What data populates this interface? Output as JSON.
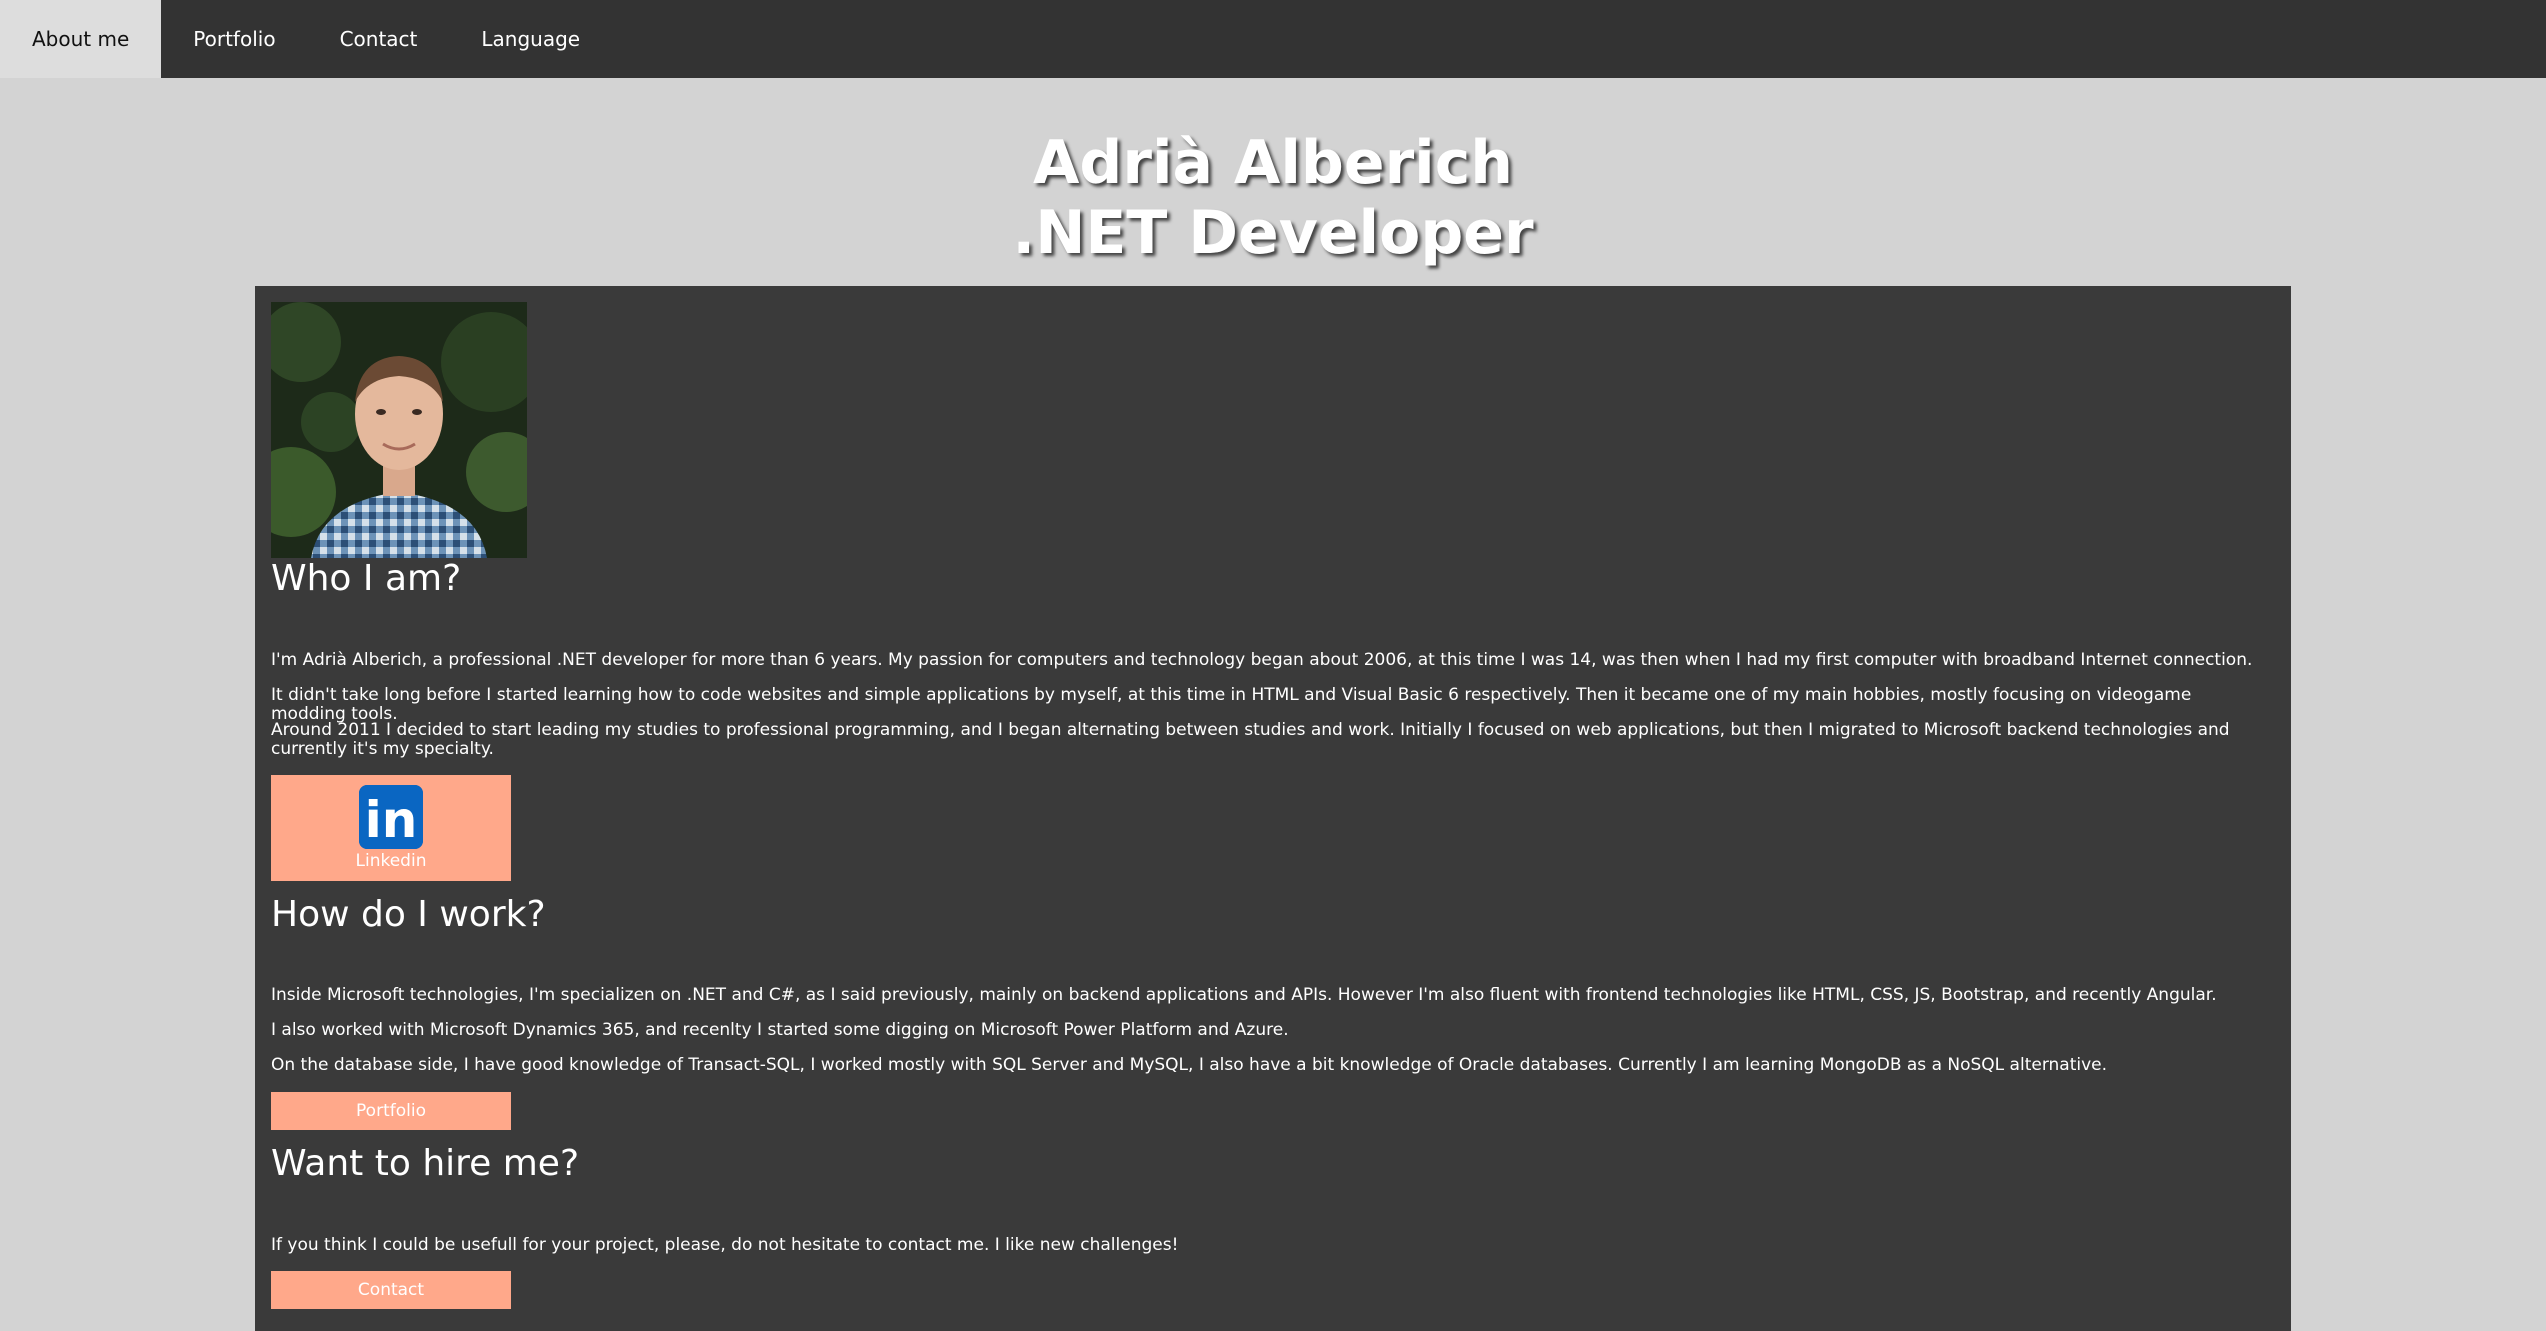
{
  "nav": {
    "items": [
      {
        "label": "About me",
        "active": true
      },
      {
        "label": "Portfolio",
        "active": false
      },
      {
        "label": "Contact",
        "active": false
      },
      {
        "label": "Language",
        "active": false
      }
    ]
  },
  "header": {
    "name": "Adrià Alberich",
    "role": ".NET Developer"
  },
  "about": {
    "title": "Who I am?",
    "paragraphs": [
      "I'm Adrià Alberich, a professional .NET developer for more than 6 years. My passion for computers and technology began about 2006, at this time I was 14, was then when I had my first computer with broadband Internet connection.",
      "It didn't take long before I started learning how to code websites and simple applications by myself, at this time in HTML and Visual Basic 6 respectively. Then it became one of my main hobbies, mostly focusing on videogame modding tools.",
      "Around 2011 I decided to start leading my studies to professional programming, and I began alternating between studies and work. Initially I focused on web applications, but then I migrated to Microsoft backend technologies and currently it's my specialty."
    ],
    "linkedin_label": "Linkedin",
    "linkedin_logo_text": "in"
  },
  "work": {
    "title": "How do I work?",
    "paragraphs": [
      "Inside Microsoft technologies, I'm specializen on .NET and C#, as I said previously, mainly on backend applications and APIs. However I'm also fluent with frontend technologies like HTML, CSS, JS, Bootstrap, and recently Angular.",
      "I also worked with Microsoft Dynamics 365, and recenlty I started some digging on Microsoft Power Platform and Azure.",
      "On the database side, I have good knowledge of Transact-SQL, I worked mostly with SQL Server and MySQL, I also have a bit knowledge of Oracle databases. Currently I am learning MongoDB as a NoSQL alternative."
    ],
    "portfolio_button": "Portfolio"
  },
  "hire": {
    "title": "Want to hire me?",
    "paragraph": "If you think I could be usefull for your project, please, do not hesitate to contact me. I like new challenges!",
    "contact_button": "Contact"
  },
  "colors": {
    "navbar": "#333333",
    "nav_active": "#dddddd",
    "background": "#d3d3d3",
    "content": "#3a3a3a",
    "button": "#ffa88a",
    "linkedin_blue": "#0a66c2"
  },
  "icons": {
    "linkedin": "linkedin-icon"
  }
}
